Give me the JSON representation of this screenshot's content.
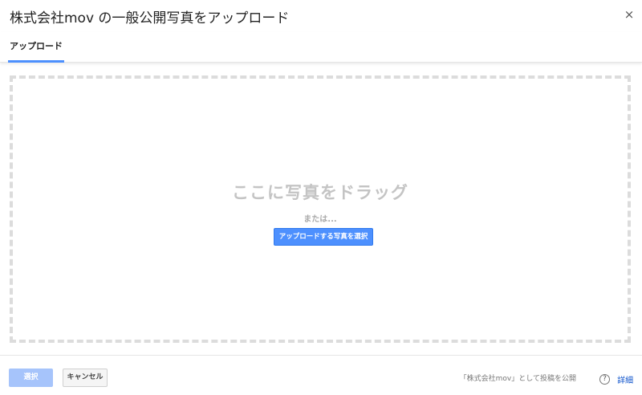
{
  "dialog": {
    "title": "株式会社mov の一般公開写真をアップロード",
    "close_glyph": "×"
  },
  "tabs": [
    {
      "label": "アップロード",
      "selected": true
    }
  ],
  "dropzone": {
    "heading": "ここに写真をドラッグ",
    "or_text": "または...",
    "select_button_label": "アップロードする写真を選択"
  },
  "footer": {
    "select_button_label": "選択",
    "cancel_button_label": "キャンセル",
    "publish_as_text": "「株式会社mov」として投稿を公開",
    "help_icon_glyph": "?",
    "help_label": "詳細"
  },
  "colors": {
    "accent": "#4d90fe",
    "disabled_primary": "#a6c4fb",
    "link": "#1155cc"
  }
}
